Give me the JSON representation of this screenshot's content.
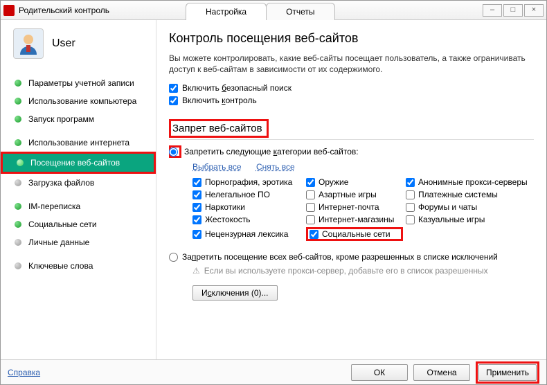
{
  "window": {
    "title": "Родительский контроль",
    "tabs": [
      "Настройка",
      "Отчеты"
    ],
    "activeTab": 0
  },
  "sidebar": {
    "username": "User",
    "items": [
      {
        "label": "Параметры учетной записи",
        "status": "green"
      },
      {
        "label": "Использование компьютера",
        "status": "green"
      },
      {
        "label": "Запуск программ",
        "status": "green"
      },
      {
        "label": "Использование интернета",
        "status": "green",
        "spacer": true
      },
      {
        "label": "Посещение веб-сайтов",
        "status": "green",
        "active": true
      },
      {
        "label": "Загрузка файлов",
        "status": "gray"
      },
      {
        "label": "IM-переписка",
        "status": "green",
        "spacer": true
      },
      {
        "label": "Социальные сети",
        "status": "green"
      },
      {
        "label": "Личные данные",
        "status": "gray"
      },
      {
        "label": "Ключевые слова",
        "status": "gray",
        "spacer": true
      }
    ]
  },
  "main": {
    "heading": "Контроль посещения веб-сайтов",
    "description": "Вы можете контролировать, какие веб-сайты посещает пользователь, а также ограничивать доступ к веб-сайтам в зависимости от их содержимого.",
    "chk_safe_search_pre": "Включить ",
    "chk_safe_search_u": "б",
    "chk_safe_search_post": "езопасный поиск",
    "chk_control_pre": "Включить ",
    "chk_control_u": "к",
    "chk_control_post": "онтроль",
    "section_title": "Запрет веб-сайтов",
    "radio_categories_pre": "Запретить следующие ",
    "radio_categories_u": "к",
    "radio_categories_post": "атегории веб-сайтов:",
    "link_select_all": "Выбрать все",
    "link_clear_all": "Снять все",
    "categories": {
      "col1": [
        {
          "label": "Порнография, эротика",
          "checked": true
        },
        {
          "label": "Нелегальное ПО",
          "checked": true
        },
        {
          "label": "Наркотики",
          "checked": true
        },
        {
          "label": "Жестокость",
          "checked": true
        },
        {
          "label": "Нецензурная лексика",
          "checked": true
        }
      ],
      "col2": [
        {
          "label": "Оружие",
          "checked": true
        },
        {
          "label": "Азартные игры",
          "checked": false
        },
        {
          "label": "Интернет-почта",
          "checked": false
        },
        {
          "label": "Интернет-магазины",
          "checked": false
        },
        {
          "label": "Социальные сети",
          "checked": true,
          "highlight": true
        }
      ],
      "col3": [
        {
          "label": "Анонимные прокси-серверы",
          "checked": true
        },
        {
          "label": "Платежные системы",
          "checked": false
        },
        {
          "label": "Форумы и чаты",
          "checked": false
        },
        {
          "label": "Казуальные игры",
          "checked": false
        }
      ]
    },
    "radio_block_all_pre": "За",
    "radio_block_all_u": "п",
    "radio_block_all_post": "ретить посещение всех веб-сайтов, кроме разрешенных в списке исключений",
    "proxy_warning": "Если вы используете прокси-сервер, добавьте его в список разрешенных",
    "exclusions_btn_pre": "И",
    "exclusions_btn_u": "с",
    "exclusions_btn_post": "ключения (0)..."
  },
  "footer": {
    "help": "Справка",
    "ok": "ОК",
    "cancel": "Отмена",
    "apply": "Применить"
  }
}
